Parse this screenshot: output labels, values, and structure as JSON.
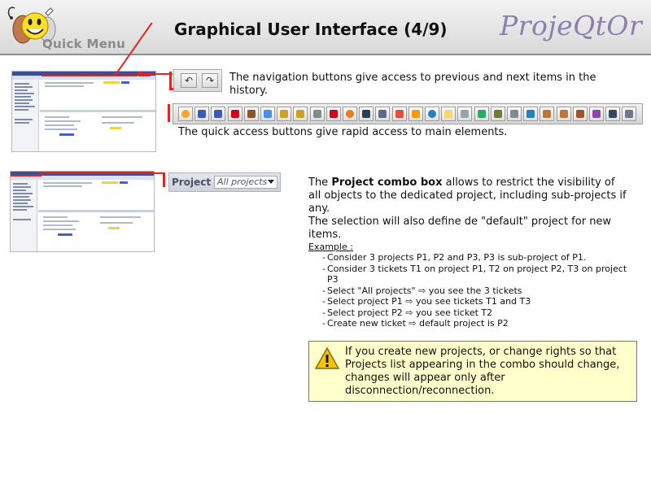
{
  "header": {
    "quick_menu_label": "Quick Menu",
    "title": "Graphical User Interface (4/9)",
    "brand": "ProjeQtOr"
  },
  "navigation": {
    "description": "The navigation buttons give access to previous and next items in the history.",
    "buttons": [
      {
        "name": "back",
        "icon": "undo-arrow-icon"
      },
      {
        "name": "forward",
        "icon": "redo-arrow-icon"
      }
    ]
  },
  "quick_access": {
    "description": "The quick access buttons give rapid access to main elements.",
    "icons": [
      "today-icon",
      "planning-icon",
      "monitor-icon",
      "flag-icon",
      "ticket-icon",
      "activity-icon",
      "money-bag-icon",
      "money-bag2-icon",
      "document-icon",
      "milestone-icon",
      "stop-icon",
      "meeting-icon",
      "monitor2-icon",
      "bubble-icon",
      "warning-circle-icon",
      "help-circle-icon",
      "hand-icon",
      "speech-icon",
      "sync-icon",
      "user-icon",
      "team-icon",
      "gear-icon",
      "box-icon",
      "box2-icon",
      "contact-icon",
      "resource-icon",
      "calendar-icon",
      "admin-icon"
    ],
    "colors": {
      "accent": "#e42424"
    }
  },
  "project_combo": {
    "label": "Project",
    "selected": "All projects"
  },
  "project_text": {
    "intro_prefix": "The ",
    "intro_bold": "Project combo box",
    "intro_suffix": " allows to restrict the visibility of all objects to the dedicated project, including sub-projects if any.",
    "default_text": "The selection will also define de \"default\" project for new items.",
    "example_title": "Example :",
    "examples": [
      "Consider 3 projects P1, P2 and P3, P3 is sub-project of P1.",
      "Consider 3 tickets T1 on project P1, T2 on project P2, T3 on project P3",
      "Select \"All projects\" ⇨ you see the 3 tickets",
      "Select project P1 ⇨ you see tickets T1 and T3",
      "Select project P2 ⇨ you see ticket T2",
      "Create new ticket ⇨ default project is P2"
    ]
  },
  "warning": {
    "text": "If you create new projects, or change rights so that Projects list appearing in the combo should change, changes will appear only after disconnection/reconnection."
  }
}
